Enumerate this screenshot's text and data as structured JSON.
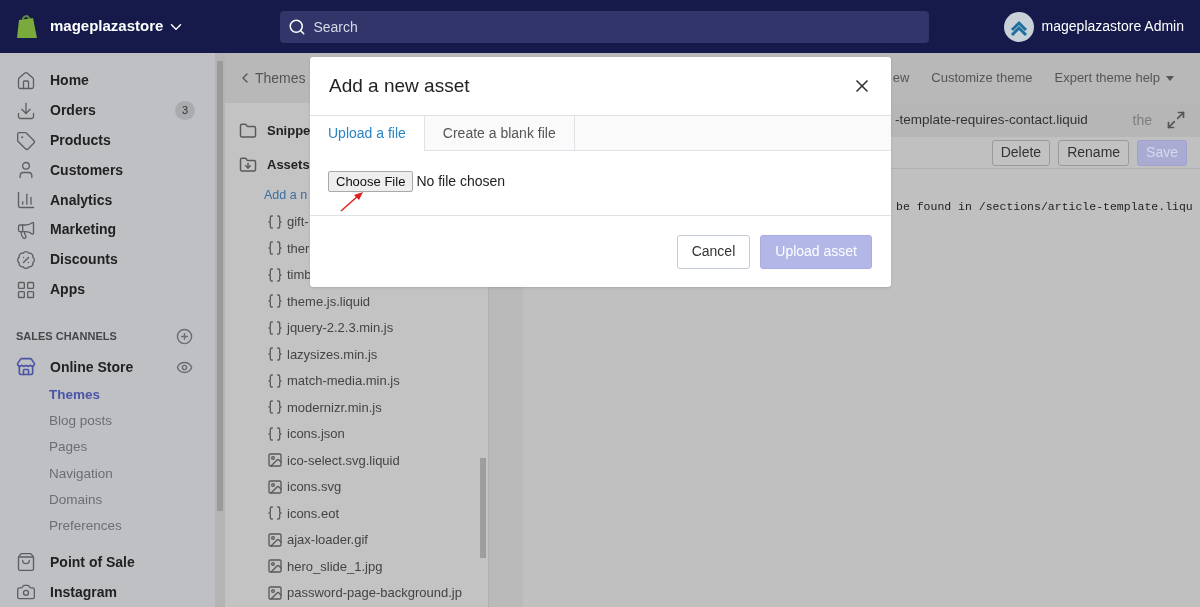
{
  "topbar": {
    "store": "mageplazastore",
    "search": {
      "placeholder": "Search"
    },
    "user": "mageplazastore Admin"
  },
  "sidebar": {
    "items": [
      {
        "label": "Home",
        "selected": false
      },
      {
        "label": "Orders",
        "badge": "3",
        "selected": false
      },
      {
        "label": "Products",
        "selected": false
      },
      {
        "label": "Customers",
        "selected": false
      },
      {
        "label": "Analytics",
        "selected": false
      },
      {
        "label": "Marketing",
        "selected": false
      },
      {
        "label": "Discounts",
        "selected": false
      },
      {
        "label": "Apps",
        "selected": false
      }
    ],
    "section_title": "SALES CHANNELS",
    "channel": {
      "label": "Online Store",
      "children": [
        {
          "label": "Themes",
          "selected": true
        },
        {
          "label": "Blog posts",
          "selected": false
        },
        {
          "label": "Pages",
          "selected": false
        },
        {
          "label": "Navigation",
          "selected": false
        },
        {
          "label": "Domains",
          "selected": false
        },
        {
          "label": "Preferences",
          "selected": false
        }
      ]
    },
    "more_channels": [
      {
        "label": "Point of Sale"
      },
      {
        "label": "Instagram"
      }
    ]
  },
  "header": {
    "back": "Themes",
    "actions": [
      {
        "label": "ew",
        "dropdown": false
      },
      {
        "label": "Customize theme",
        "dropdown": false
      },
      {
        "label": "Expert theme help",
        "dropdown": true
      }
    ]
  },
  "files": {
    "folders": [
      {
        "label": "Snippe",
        "kind": "folder"
      },
      {
        "label": "Assets",
        "kind": "folder-open"
      }
    ],
    "add_link": "Add a n",
    "items": [
      {
        "label": "gift-",
        "kind": "code"
      },
      {
        "label": "ther",
        "kind": "code"
      },
      {
        "label": "timb",
        "kind": "code"
      },
      {
        "label": "theme.js.liquid",
        "kind": "code"
      },
      {
        "label": "jquery-2.2.3.min.js",
        "kind": "code"
      },
      {
        "label": "lazysizes.min.js",
        "kind": "code"
      },
      {
        "label": "match-media.min.js",
        "kind": "code"
      },
      {
        "label": "modernizr.min.js",
        "kind": "code"
      },
      {
        "label": "icons.json",
        "kind": "code"
      },
      {
        "label": "ico-select.svg.liquid",
        "kind": "image"
      },
      {
        "label": "icons.svg",
        "kind": "image"
      },
      {
        "label": "icons.eot",
        "kind": "code"
      },
      {
        "label": "ajax-loader.gif",
        "kind": "image"
      },
      {
        "label": "hero_slide_1.jpg",
        "kind": "image"
      },
      {
        "label": "password-page-background.jp",
        "kind": "image"
      }
    ]
  },
  "editor": {
    "tab": "-template-requires-contact.liquid",
    "tab_faded": "the",
    "buttons": [
      {
        "label": "Delete",
        "disabled": false
      },
      {
        "label": "Rename",
        "disabled": false
      },
      {
        "label": "Save",
        "disabled": true
      }
    ],
    "code_line": "be found in /sections/article-template.liqu"
  },
  "dialog": {
    "title": "Add a new asset",
    "tabs": [
      {
        "label": "Upload a file",
        "selected": true
      },
      {
        "label": "Create a blank file",
        "selected": false
      }
    ],
    "file_button": "Choose File",
    "file_status": "No file chosen",
    "buttons": [
      {
        "label": "Cancel",
        "disabled": false
      },
      {
        "label": "Upload asset",
        "disabled": true
      }
    ]
  }
}
